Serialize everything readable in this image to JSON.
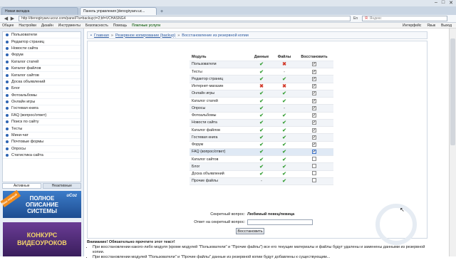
{
  "browser": {
    "tabs": [
      {
        "label": "Новая вкладка"
      },
      {
        "label": "Панель управления [denogiryaev.uc..."
      }
    ],
    "window_controls": [
      "–",
      "□",
      "✕"
    ],
    "url": "http://denogiryaev.ucoz.com/panel/?a=backup;t=2;bf=VCHASNG4",
    "search_placeholder": "Яндекс",
    "lang_indicator": "En",
    "menu": [
      "Общее",
      "Настройки",
      "Дизайн",
      "Инструменты",
      "Безопасность",
      "Помощь",
      "Платные услуги"
    ],
    "menu_right": [
      "Интерфейс",
      "Язык",
      "Выход"
    ]
  },
  "sidebar": {
    "items": [
      {
        "label": "Пользователи"
      },
      {
        "label": "Редактор страниц"
      },
      {
        "label": "Новости сайта"
      },
      {
        "label": "Форум"
      },
      {
        "label": "Каталог статей"
      },
      {
        "label": "Каталог файлов"
      },
      {
        "label": "Каталог сайтов"
      },
      {
        "label": "Доска объявлений"
      },
      {
        "label": "Блог"
      },
      {
        "label": "Фотоальбомы"
      },
      {
        "label": "Онлайн игры"
      },
      {
        "label": "Гостевая книга"
      },
      {
        "label": "FAQ (вопрос/ответ)"
      },
      {
        "label": "Поиск по сайту"
      },
      {
        "label": "Тесты"
      },
      {
        "label": "Мини-чат"
      },
      {
        "label": "Почтовые формы"
      },
      {
        "label": "Опросы"
      },
      {
        "label": "Статистика сайта"
      }
    ],
    "tabs": {
      "active": "Активные",
      "inactive": "Неактивные"
    },
    "banner1": {
      "line1": "ПОЛНОЕ",
      "line2": "ОПИСАНИЕ",
      "line3": "СИСТЕМЫ",
      "brand": "uCoz",
      "tag": "Ваш первый"
    },
    "banner2": {
      "line1": "КОНКУРС",
      "line2": "ВИДЕОУРОКОВ"
    }
  },
  "breadcrumb": {
    "home": "Главная",
    "section": "Резервное копирование (backup)",
    "current": "Восстановление из резервной копии",
    "sep": "»"
  },
  "table": {
    "headers": {
      "module": "Модуль",
      "data": "Данные",
      "files": "Файлы",
      "restore": "Восстановить"
    },
    "rows": [
      {
        "name": "Пользователи",
        "data": "ok",
        "files": "no",
        "restore": "checked"
      },
      {
        "name": "Тесты",
        "data": "ok",
        "files": "dash",
        "restore": "checked"
      },
      {
        "name": "Редактор страниц",
        "data": "ok",
        "files": "ok",
        "restore": "checked"
      },
      {
        "name": "Интернет-магазин",
        "data": "no",
        "files": "no",
        "restore": "checked"
      },
      {
        "name": "Онлайн игры",
        "data": "ok",
        "files": "ok",
        "restore": "checked"
      },
      {
        "name": "Каталог статей",
        "data": "ok",
        "files": "ok",
        "restore": "checked"
      },
      {
        "name": "Опросы",
        "data": "ok",
        "files": "dash",
        "restore": "checked"
      },
      {
        "name": "Фотоальбомы",
        "data": "ok",
        "files": "ok",
        "restore": "checked"
      },
      {
        "name": "Новости сайта",
        "data": "ok",
        "files": "ok",
        "restore": "checked"
      },
      {
        "name": "Каталог файлов",
        "data": "ok",
        "files": "ok",
        "restore": "checked"
      },
      {
        "name": "Гостевая книга",
        "data": "ok",
        "files": "ok",
        "restore": "checked"
      },
      {
        "name": "Форум",
        "data": "ok",
        "files": "ok",
        "restore": "checked"
      },
      {
        "name": "FAQ (вопрос/ответ)",
        "data": "ok",
        "files": "ok",
        "restore": "focus"
      },
      {
        "name": "Каталог сайтов",
        "data": "ok",
        "files": "ok",
        "restore": "unchecked"
      },
      {
        "name": "Блог",
        "data": "ok",
        "files": "ok",
        "restore": "unchecked"
      },
      {
        "name": "Доска объявлений",
        "data": "ok",
        "files": "ok",
        "restore": "unchecked"
      },
      {
        "name": "Прочие файлы",
        "data": "dash",
        "files": "ok",
        "restore": "unchecked"
      }
    ]
  },
  "secret": {
    "question_label": "Секретный вопрос:",
    "question_value": "Любимый певец/певица",
    "answer_label": "Ответ на секретный вопрос:",
    "button": "Восстановить"
  },
  "notice": {
    "head": "Внимание! Обязательно прочтите этот текст!",
    "item1": "При восстановлении какого-либо модуля (кроме модулей \"Пользователи\" и \"Прочие файлы\") все его текущие материалы и файлы будут удалены и заменены данными из резервной копии.",
    "item2": "При восстановлении модулей \"Пользователи\" и \"Прочие файлы\" данные из резервной копии будут добавлены к существующим..."
  }
}
